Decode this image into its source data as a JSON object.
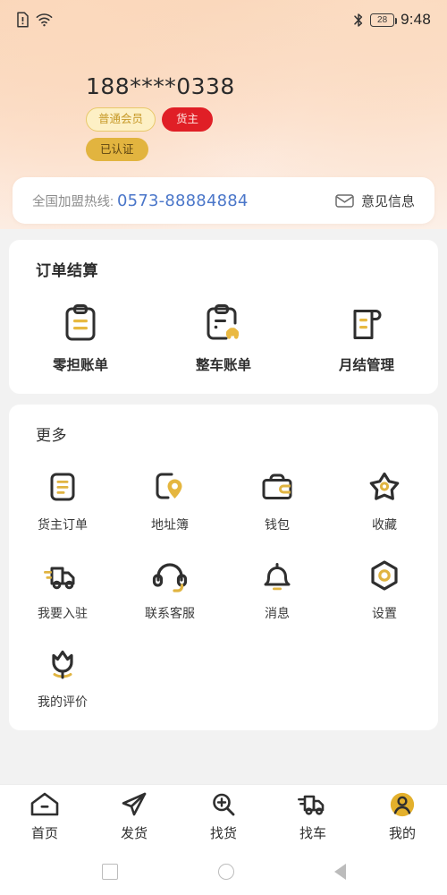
{
  "status_bar": {
    "sim_icon": "sim-warning-icon",
    "wifi_icon": "wifi-icon",
    "bluetooth_icon": "bluetooth-icon",
    "battery_level": "28",
    "time": "9:48"
  },
  "profile": {
    "phone": "188****0338",
    "badges": [
      {
        "label": "普通会员",
        "style": "member"
      },
      {
        "label": "货主",
        "style": "owner"
      },
      {
        "label": "已认证",
        "style": "verified"
      }
    ]
  },
  "hotline": {
    "label": "全国加盟热线:",
    "number": "0573-88884884",
    "feedback_label": "意见信息",
    "feedback_icon": "envelope-icon",
    "number_color": "#4a76c9"
  },
  "settlement": {
    "title": "订单结算",
    "items": [
      {
        "label": "零担账单",
        "icon": "clipboard-icon"
      },
      {
        "label": "整车账单",
        "icon": "clipboard-car-icon"
      },
      {
        "label": "月结管理",
        "icon": "document-curl-icon"
      }
    ]
  },
  "more": {
    "title": "更多",
    "items": [
      {
        "label": "货主订单",
        "icon": "order-list-icon"
      },
      {
        "label": "地址簿",
        "icon": "address-pin-icon"
      },
      {
        "label": "钱包",
        "icon": "wallet-icon"
      },
      {
        "label": "收藏",
        "icon": "star-icon"
      },
      {
        "label": "我要入驻",
        "icon": "truck-icon"
      },
      {
        "label": "联系客服",
        "icon": "headset-icon"
      },
      {
        "label": "消息",
        "icon": "bell-icon"
      },
      {
        "label": "设置",
        "icon": "hex-gear-icon"
      },
      {
        "label": "我的评价",
        "icon": "flower-icon"
      }
    ]
  },
  "tabbar": {
    "active_index": 4,
    "accent": "#e3b02c",
    "tabs": [
      {
        "label": "首页",
        "icon": "home-icon"
      },
      {
        "label": "发货",
        "icon": "send-icon"
      },
      {
        "label": "找货",
        "icon": "search-plus-icon"
      },
      {
        "label": "找车",
        "icon": "truck-find-icon"
      },
      {
        "label": "我的",
        "icon": "user-circle-icon"
      }
    ]
  },
  "system_nav": {
    "recents": "square-icon",
    "home": "circle-icon",
    "back": "triangle-back-icon"
  }
}
